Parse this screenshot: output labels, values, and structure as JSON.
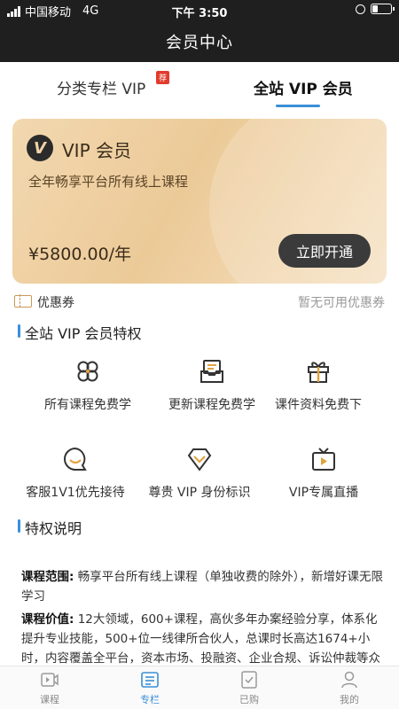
{
  "status_bar": {
    "carrier": "中国移动",
    "network": "4G",
    "time": "下午 3:50",
    "battery_level": 0.3
  },
  "nav": {
    "title": "会员中心"
  },
  "tabs": {
    "left_label": "分类专栏 VIP",
    "badge": "荐",
    "right_label": "全站 VIP 会员",
    "active": "right"
  },
  "vip_card": {
    "logo_letter": "V",
    "title": "VIP 会员",
    "subtitle": "全年畅享平台所有线上课程",
    "price": "¥5800.00/年",
    "button": "立即开通"
  },
  "coupon": {
    "label": "优惠券",
    "status": "暂无可用优惠券"
  },
  "privileges": {
    "title": "全站 VIP 会员特权",
    "items": [
      {
        "label": "所有课程免费学",
        "icon": "clover-icon"
      },
      {
        "label": "更新课程免费学",
        "icon": "inbox-icon"
      },
      {
        "label": "课件资料免费下",
        "icon": "gift-icon"
      },
      {
        "label": "客服1V1优先接待",
        "icon": "chat-smile-icon"
      },
      {
        "label": "尊贵 VIP 身份标识",
        "icon": "diamond-icon"
      },
      {
        "label": "VIP专属直播",
        "icon": "tv-play-icon"
      }
    ]
  },
  "description": {
    "title": "特权说明",
    "scope_label": "课程范围:",
    "scope_text": "畅享平台所有线上课程（单独收费的除外），新增好课无限学习",
    "value_label": "课程价值:",
    "value_text": "12大领域，600+课程，高伙多年办案经验分享，体系化提升专业技能，500+位一线律所合伙人，总课时长高达1674+小时，内容覆盖全平台，资本市场、投融资、企业合规、诉讼仲裁等众多好课无限畅看"
  },
  "tabbar": {
    "items": [
      {
        "label": "课程",
        "icon": "video-icon"
      },
      {
        "label": "专栏",
        "icon": "column-icon"
      },
      {
        "label": "已购",
        "icon": "purchased-icon"
      },
      {
        "label": "我的",
        "icon": "user-icon"
      }
    ],
    "active": "专栏"
  },
  "colors": {
    "accent": "#3a8fd8",
    "card_gold": "#ecca98",
    "button_dark": "#3b3b3b",
    "badge_red": "#e23b2e"
  }
}
